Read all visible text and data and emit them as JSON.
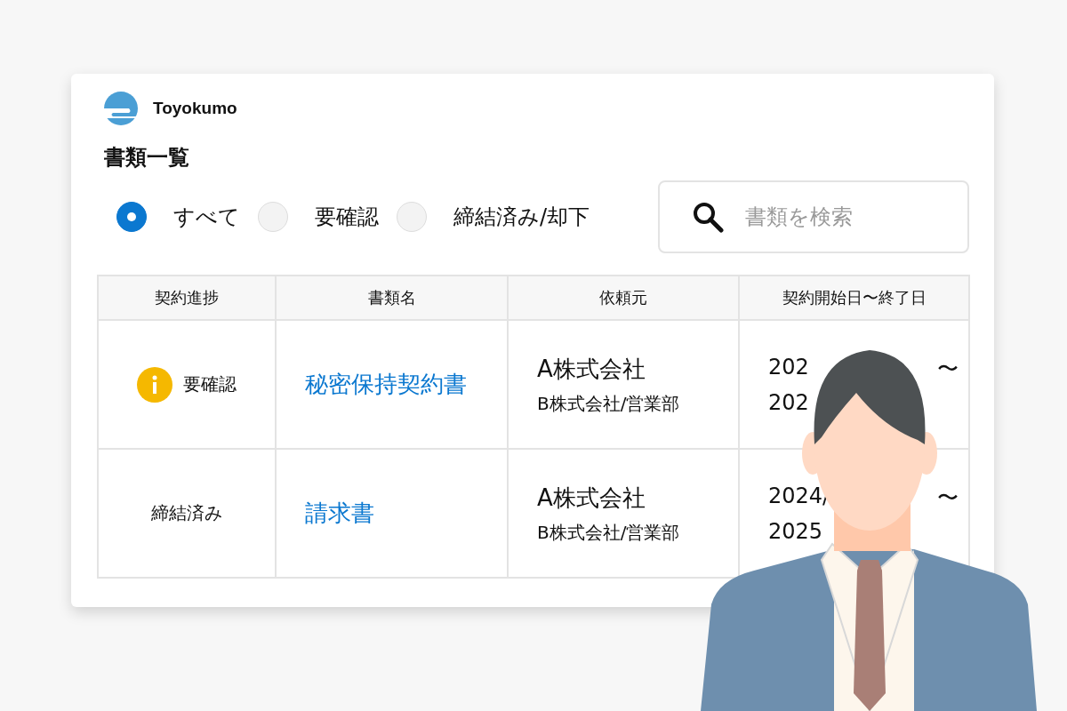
{
  "brand": {
    "name": "Toyokumo"
  },
  "title": "書類一覧",
  "filters": [
    {
      "label": "すべて",
      "selected": true
    },
    {
      "label": "要確認",
      "selected": false
    },
    {
      "label": "締結済み/却下",
      "selected": false
    }
  ],
  "search": {
    "placeholder": "書類を検索"
  },
  "table": {
    "columns": [
      "契約進捗",
      "書類名",
      "依頼元",
      "契約開始日〜終了日"
    ],
    "rows": [
      {
        "status": {
          "kind": "warning",
          "label": "要確認"
        },
        "document": "秘密保持契約書",
        "requester": "A株式会社",
        "department": "B株式会社/営業部",
        "period_start": "202",
        "period_end": "〜",
        "period_line2": "202"
      },
      {
        "status": {
          "kind": "done",
          "label": "締結済み"
        },
        "document": "請求書",
        "requester": "A株式会社",
        "department": "B株式会社/営業部",
        "period_start": "2024/",
        "period_end": "〜",
        "period_line2": "2025"
      }
    ]
  }
}
